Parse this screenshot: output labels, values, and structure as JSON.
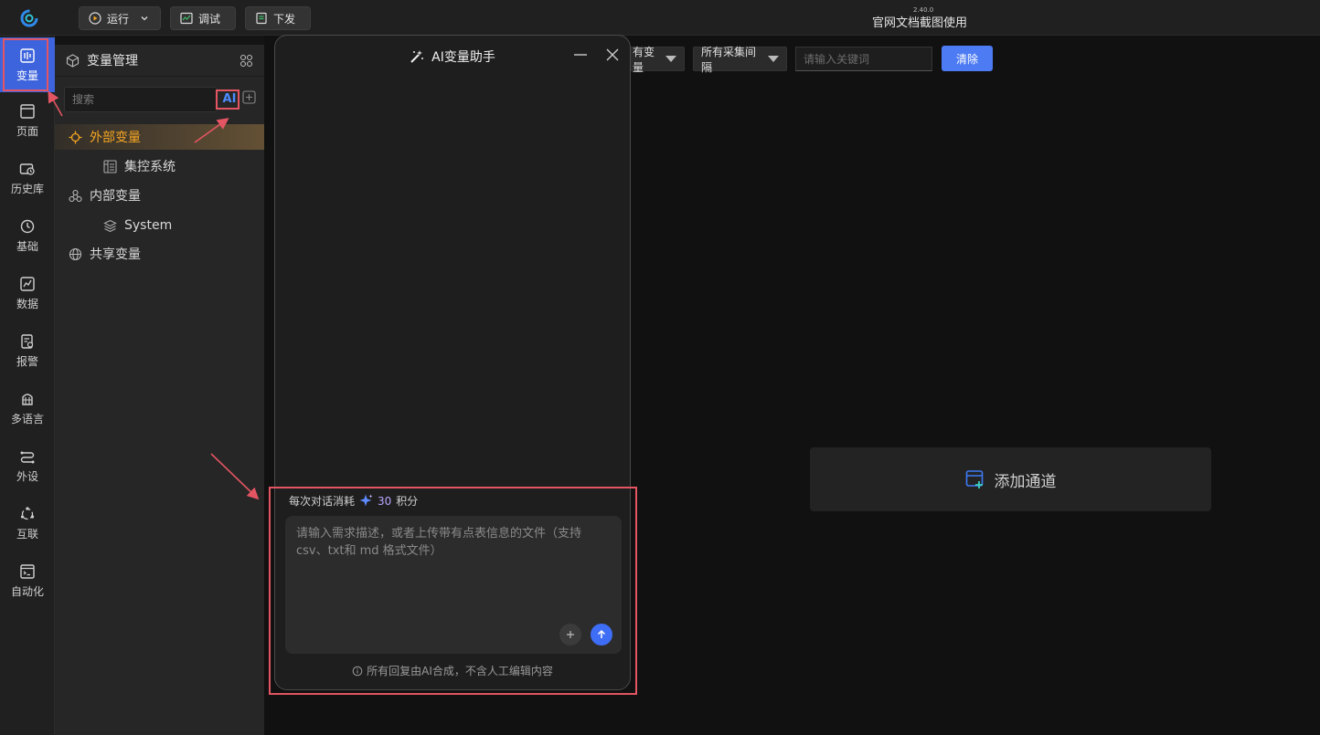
{
  "topbar": {
    "run_label": "运行",
    "debug_label": "调试",
    "deploy_label": "下发",
    "version": "2.40.0",
    "title": "官网文档截图使用"
  },
  "nav": {
    "items": [
      {
        "label": "变量",
        "icon": "variable-icon",
        "active": true
      },
      {
        "label": "页面",
        "icon": "page-icon"
      },
      {
        "label": "历史库",
        "icon": "history-icon"
      },
      {
        "label": "基础",
        "icon": "basic-icon"
      },
      {
        "label": "数据",
        "icon": "data-icon"
      },
      {
        "label": "报警",
        "icon": "alarm-icon"
      },
      {
        "label": "多语言",
        "icon": "language-icon"
      },
      {
        "label": "外设",
        "icon": "peripheral-icon"
      },
      {
        "label": "互联",
        "icon": "interconnect-icon"
      },
      {
        "label": "自动化",
        "icon": "automation-icon"
      }
    ]
  },
  "varpanel": {
    "title": "变量管理",
    "search_placeholder": "搜索",
    "ai_label": "AI",
    "tree": [
      {
        "label": "外部变量",
        "selected": true
      },
      {
        "label": "集控系统"
      },
      {
        "label": "内部变量"
      },
      {
        "label": "System"
      },
      {
        "label": "共享变量"
      }
    ]
  },
  "main": {
    "filter_var": "有变量",
    "filter_interval": "所有采集间隔",
    "keyword_placeholder": "请输入关键词",
    "clear_label": "清除",
    "add_channel_label": "添加通道"
  },
  "ai_dialog": {
    "title": "AI变量助手",
    "cost_prefix": "每次对话消耗",
    "cost_value": "30",
    "cost_unit": "积分",
    "input_placeholder": "请输入需求描述，或者上传带有点表信息的文件（支持 csv、txt和 md 格式文件）",
    "disclaimer": "所有回复由AI合成，不含人工编辑内容"
  },
  "colors": {
    "accent": "#3d63dd",
    "selected_text": "#f5a623",
    "annotation": "#e35562"
  }
}
